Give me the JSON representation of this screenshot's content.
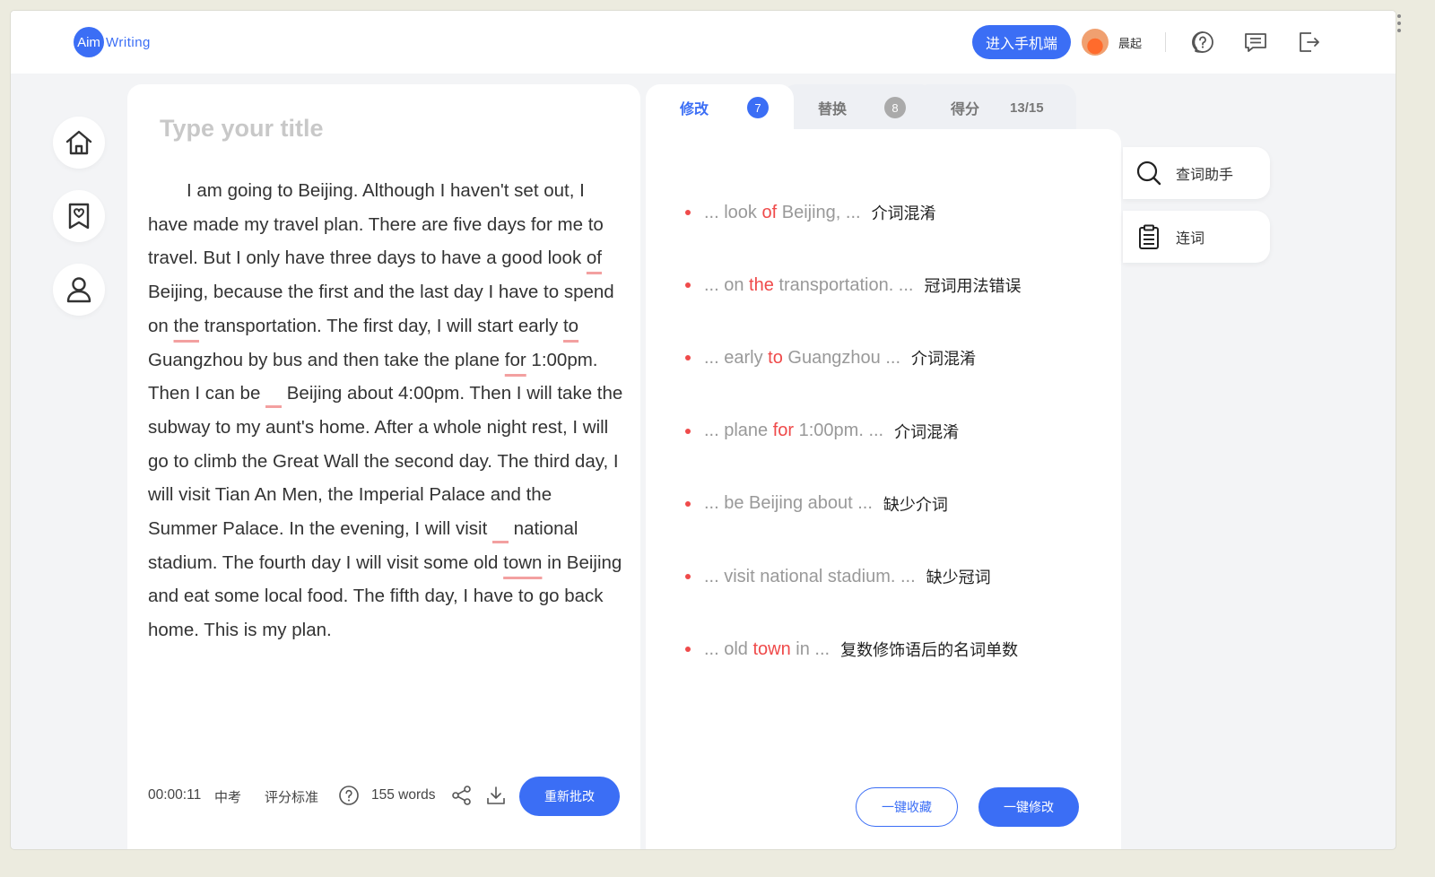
{
  "header": {
    "logo_prefix": "Aim",
    "logo_suffix": "Writing",
    "mobile_button": "进入手机端",
    "username": "晨起"
  },
  "editor": {
    "title_placeholder": "Type your title",
    "essay": {
      "p01": "I am going to Beijing. Although I haven't set out, I have made my travel plan. There are five days for me to travel. But I only have three days to have a good look ",
      "e01": "of",
      "p02": " Beijing, because the first and the last day I have to spend on ",
      "e02": "the",
      "p03": " transportation. The first day, I will start early ",
      "e03": "to",
      "p04": " Guangzhou by bus and then take the plane ",
      "e04": "for",
      "p05": " 1:00pm. Then I can be ",
      "p06": " Beijing about 4:00pm. Then I will take the subway to my aunt's home. After a whole night rest, I will go to climb the Great Wall the second day. The third day, I will visit Tian An Men, the Imperial Palace and the Summer Palace. In the evening, I will visit ",
      "p07": " national stadium. The fourth day I will visit some old ",
      "e05": "town",
      "p08": " in Beijing and eat some local food. The fifth day, I have to go back home. This is my plan."
    },
    "footer": {
      "timer": "00:00:11",
      "level": "中考",
      "criteria": "评分标准",
      "word_count": "155 words",
      "recheck_button": "重新批改"
    }
  },
  "tabs": [
    {
      "label": "修改",
      "count": "7"
    },
    {
      "label": "替换",
      "count": "8"
    },
    {
      "label": "得分",
      "score": "13/15"
    }
  ],
  "suggestions": [
    {
      "pre": "... look ",
      "hl": "of",
      "post": " Beijing, ...",
      "type": "介词混淆"
    },
    {
      "pre": "... on ",
      "hl": "the",
      "post": " transportation. ...",
      "type": "冠词用法错误"
    },
    {
      "pre": "... early ",
      "hl": "to",
      "post": " Guangzhou ...",
      "type": "介词混淆"
    },
    {
      "pre": "... plane ",
      "hl": "for",
      "post": " 1:00pm. ...",
      "type": "介词混淆"
    },
    {
      "pre": "... be Beijing about ...",
      "hl": "",
      "post": "",
      "type": "缺少介词"
    },
    {
      "pre": "... visit national stadium. ...",
      "hl": "",
      "post": "",
      "type": "缺少冠词"
    },
    {
      "pre": "... old ",
      "hl": "town",
      "post": " in ...",
      "type": "复数修饰语后的名词单数"
    }
  ],
  "actions": {
    "collect_all": "一键收藏",
    "fix_all": "一键修改"
  },
  "tools": {
    "lookup": "查词助手",
    "connectives": "连词"
  },
  "colors": {
    "accent": "#3b6ef5",
    "error": "#ef4a4a",
    "underline": "#f3a0a0"
  }
}
